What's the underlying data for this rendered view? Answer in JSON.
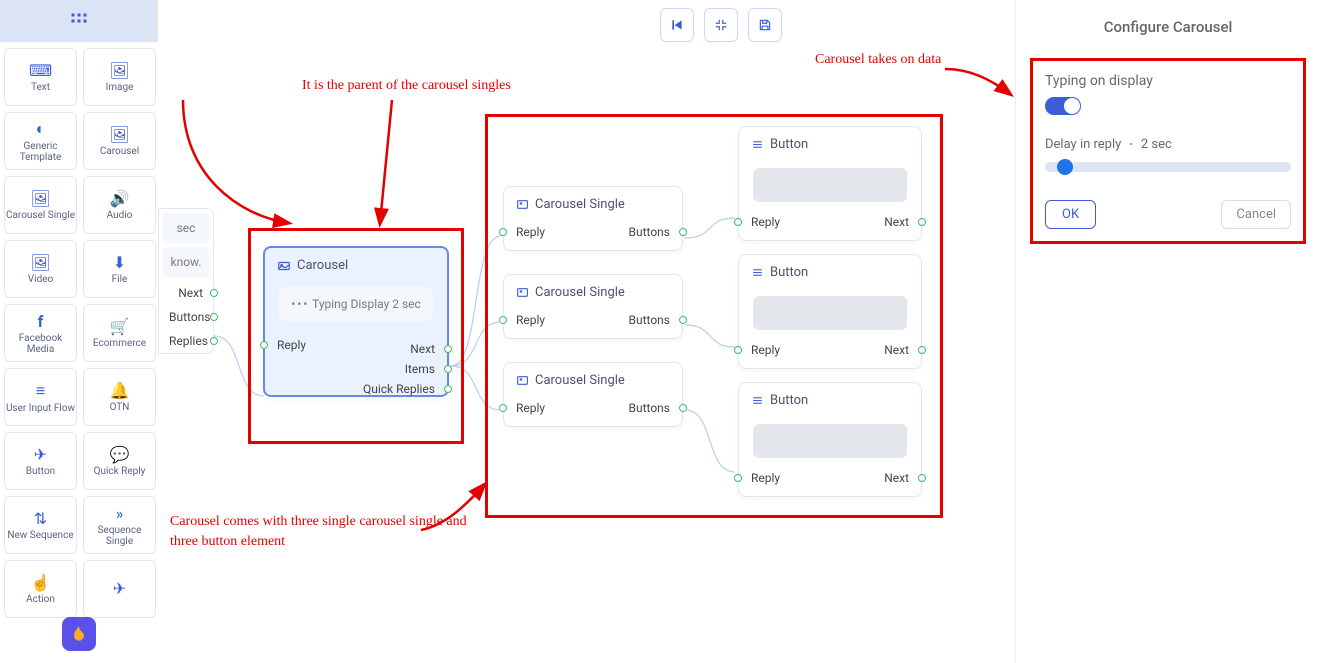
{
  "palette": {
    "items": [
      {
        "label": "Text"
      },
      {
        "label": "Image"
      },
      {
        "label": "Generic Template"
      },
      {
        "label": "Carousel"
      },
      {
        "label": "Carousel Single"
      },
      {
        "label": "Audio"
      },
      {
        "label": "Video"
      },
      {
        "label": "File"
      },
      {
        "label": "Facebook Media"
      },
      {
        "label": "Ecommerce"
      },
      {
        "label": "User Input Flow"
      },
      {
        "label": "OTN"
      },
      {
        "label": "Button"
      },
      {
        "label": "Quick Reply"
      },
      {
        "label": "New Sequence"
      },
      {
        "label": "Sequence Single"
      },
      {
        "label": "Action"
      },
      {
        "label": ""
      }
    ]
  },
  "clipped_node": {
    "chip1": "sec",
    "chip2": "know.",
    "ports": [
      "Next",
      "Buttons",
      "Replies"
    ]
  },
  "carousel_node": {
    "title": "Carousel",
    "chip": "Typing Display 2 sec",
    "out_ports": [
      "Next",
      "Items",
      "Quick Replies"
    ],
    "in_port": "Reply"
  },
  "carousel_singles": [
    {
      "title": "Carousel Single",
      "left": "Reply",
      "right": "Buttons"
    },
    {
      "title": "Carousel Single",
      "left": "Reply",
      "right": "Buttons"
    },
    {
      "title": "Carousel Single",
      "left": "Reply",
      "right": "Buttons"
    }
  ],
  "buttons": [
    {
      "title": "Button",
      "left": "Reply",
      "right": "Next"
    },
    {
      "title": "Button",
      "left": "Reply",
      "right": "Next"
    },
    {
      "title": "Button",
      "left": "Reply",
      "right": "Next"
    }
  ],
  "config": {
    "title": "Configure Carousel",
    "typing_label": "Typing on display",
    "typing_on": true,
    "delay_label": "Delay in reply",
    "delay_sep": "-",
    "delay_value": "2 sec",
    "ok": "OK",
    "cancel": "Cancel"
  },
  "annotations": {
    "parent": "It is the parent of the carousel singles",
    "data": "Carousel takes on data",
    "comes": "Carousel comes with three single carousel single and three button element"
  }
}
